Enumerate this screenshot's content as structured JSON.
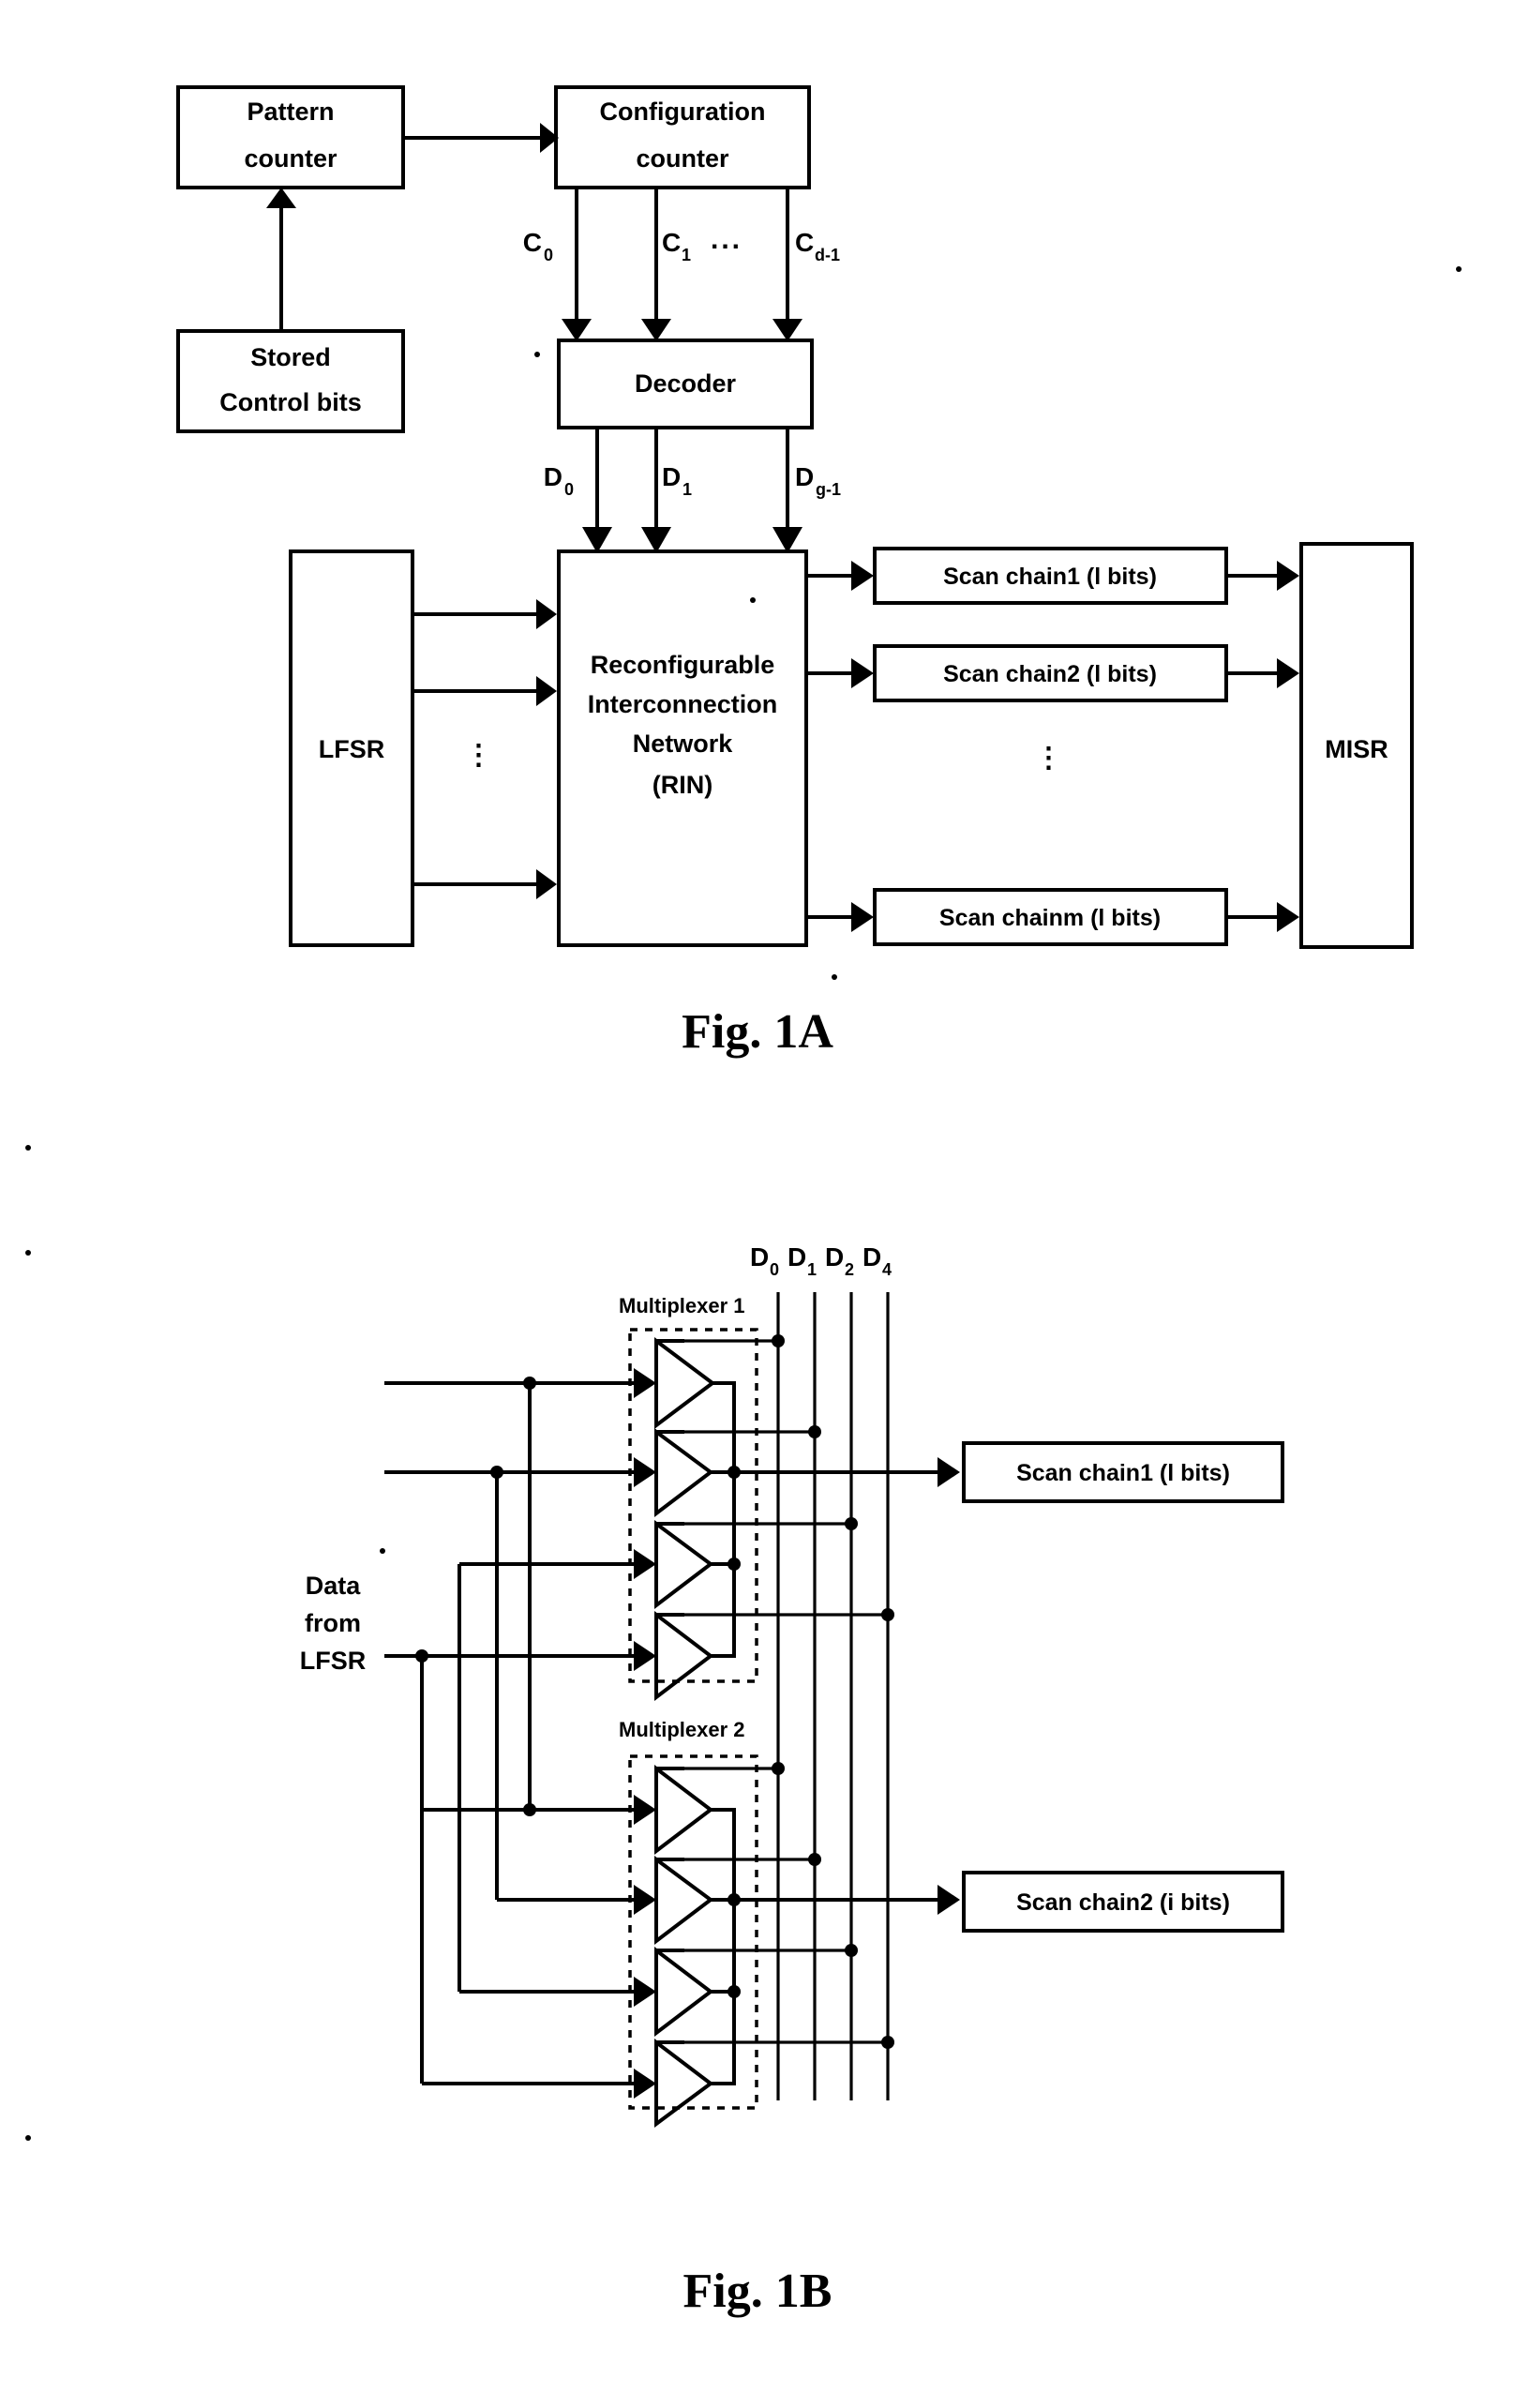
{
  "document": {
    "kind": "patent-figure-sheet",
    "background_color": "#ffffff",
    "ink_color": "#000000"
  },
  "figures": [
    {
      "id": "fig-1a",
      "caption": "Fig. 1A",
      "blocks": [
        {
          "name": "pattern-counter",
          "lines": [
            "Pattern",
            "counter"
          ]
        },
        {
          "name": "configuration-counter",
          "lines": [
            "Configuration",
            "counter"
          ]
        },
        {
          "name": "stored-control-bits",
          "lines": [
            "Stored",
            "Control bits"
          ]
        },
        {
          "name": "decoder",
          "lines": [
            "Decoder"
          ]
        },
        {
          "name": "lfsr",
          "lines": [
            "LFSR"
          ]
        },
        {
          "name": "rin",
          "lines": [
            "Reconfigurable",
            "Interconnection",
            "Network",
            "(RIN)"
          ]
        },
        {
          "name": "scan-chain-1",
          "lines": [
            "Scan chain1 (l bits)"
          ]
        },
        {
          "name": "scan-chain-2",
          "lines": [
            "Scan chain2 (l bits)"
          ]
        },
        {
          "name": "scan-chain-m",
          "lines": [
            "Scan chainm (l bits)"
          ]
        },
        {
          "name": "misr",
          "lines": [
            "MISR"
          ]
        }
      ],
      "config_signals": [
        {
          "base": "C",
          "sub": "0"
        },
        {
          "base": "C",
          "sub": "1"
        },
        {
          "base": "C",
          "sub": "d-1"
        }
      ],
      "config_ellipsis": "...",
      "decoder_signals": [
        {
          "base": "D",
          "sub": "0"
        },
        {
          "base": "D",
          "sub": "1"
        },
        {
          "base": "D",
          "sub": "g-1"
        }
      ],
      "vertical_ellipsis": "⋮"
    },
    {
      "id": "fig-1b",
      "caption": "Fig. 1B",
      "input_label_lines": [
        "Data",
        "from",
        "LFSR"
      ],
      "decoder_signals": [
        {
          "base": "D",
          "sub": "0"
        },
        {
          "base": "D",
          "sub": "1"
        },
        {
          "base": "D",
          "sub": "2"
        },
        {
          "base": "D",
          "sub": "4"
        }
      ],
      "multiplexers": [
        {
          "name": "multiplexer-1",
          "label": "Multiplexer 1",
          "buffer_count": 4
        },
        {
          "name": "multiplexer-2",
          "label": "Multiplexer 2",
          "buffer_count": 4
        }
      ],
      "blocks": [
        {
          "name": "scan-chain-1",
          "lines": [
            "Scan chain1 (l bits)"
          ]
        },
        {
          "name": "scan-chain-2",
          "lines": [
            "Scan chain2 (i bits)"
          ]
        }
      ]
    }
  ]
}
